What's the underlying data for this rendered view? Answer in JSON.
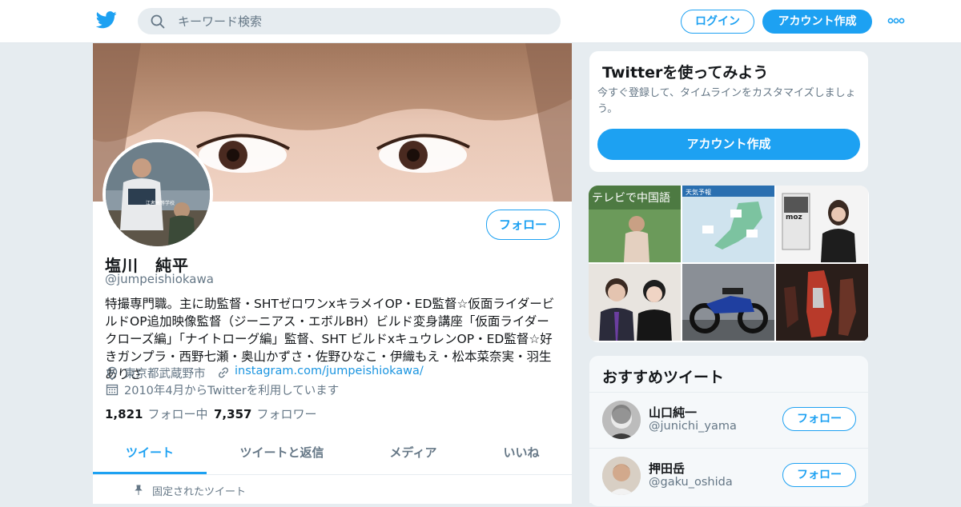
{
  "header": {
    "search_placeholder": "キーワード検索",
    "login_label": "ログイン",
    "signup_label": "アカウント作成",
    "brand_color": "#1da1f2"
  },
  "profile": {
    "follow_label": "フォロー",
    "name": "塩川　純平",
    "handle": "@jumpeishiokawa",
    "bio": "特撮専門職。主に助監督・SHTゼロワンxキラメイOP・ED監督☆仮面ライダービルドOP追加映像監督（ジーニアス・エボルBH）ビルド変身講座「仮面ライダークローズ編」「ナイトローグ編」監督、SHT ビルドxキュウレンOP・ED監督☆好きガンプラ・西野七瀬・奥山かずさ・佐野ひなこ・伊織もえ・松本菜奈実・羽生ありさ",
    "location": "東京都武蔵野市",
    "link": "instagram.com/jumpeishiokawa/",
    "joined": "2010年4月からTwitterを利用しています",
    "following_count": "1,821",
    "following_label": "フォロー中",
    "followers_count": "7,357",
    "followers_label": "フォロワー",
    "avatar_caption": "江者高等学校"
  },
  "tabs": [
    {
      "label": "ツイート",
      "active": true
    },
    {
      "label": "ツイートと返信",
      "active": false
    },
    {
      "label": "メディア",
      "active": false
    },
    {
      "label": "いいね",
      "active": false
    }
  ],
  "pinned_label": "固定されたツイート",
  "signup_card": {
    "title": "Twitterを使ってみよう",
    "text": "今すぐ登録して、タイムラインをカスタマイズしましょう。",
    "button": "アカウント作成"
  },
  "media_captions": {
    "tile1": "テレビで中国語",
    "tile2": "天気予報",
    "tile3": "moz"
  },
  "suggestions": {
    "title": "おすすめツイート",
    "items": [
      {
        "name": "山口純一",
        "handle": "@junichi_yama",
        "follow": "フォロー"
      },
      {
        "name": "押田岳",
        "handle": "@gaku_oshida",
        "follow": "フォロー"
      }
    ]
  }
}
